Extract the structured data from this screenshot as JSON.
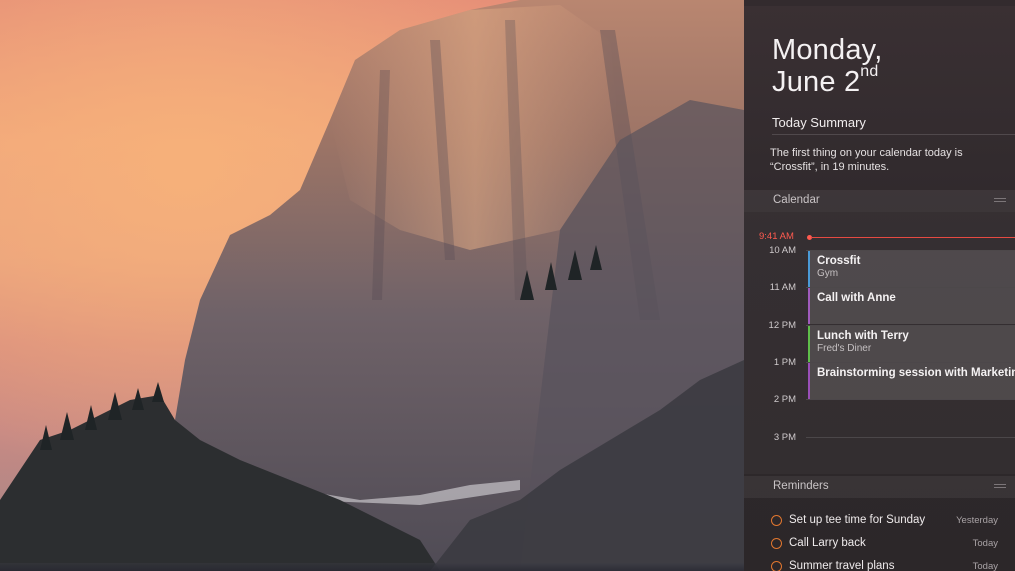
{
  "notification_center": {
    "date": {
      "weekday": "Monday,",
      "month_day": "June 2",
      "ordinal_suffix": "nd"
    },
    "today_summary": {
      "title": "Today Summary",
      "text": "The first thing on your calendar today is “Crossfit”, in 19 minutes."
    },
    "calendar": {
      "title": "Calendar",
      "current_time": "9:41 AM",
      "hours": [
        "10 AM",
        "11 AM",
        "12 PM",
        "1 PM",
        "2 PM",
        "3 PM"
      ],
      "events": [
        {
          "title": "Crossfit",
          "location": "Gym",
          "color": "#4a9ad6"
        },
        {
          "title": "Call with Anne",
          "location": "",
          "color": "#a05bbd"
        },
        {
          "title": "Lunch with Terry",
          "location": "Fred's Diner",
          "color": "#5fbf4a"
        },
        {
          "title": "Brainstorming session with Marketing",
          "location": "",
          "color": "#9a4fb8"
        }
      ]
    },
    "reminders": {
      "title": "Reminders",
      "items": [
        {
          "text": "Set up tee time for Sunday",
          "when": "Yesterday"
        },
        {
          "text": "Call Larry back",
          "when": "Today"
        },
        {
          "text": "Summer travel plans",
          "when": "Today"
        }
      ]
    }
  },
  "colors": {
    "accent_red": "#ff5a4f",
    "reminder_orange": "#e0762f"
  }
}
